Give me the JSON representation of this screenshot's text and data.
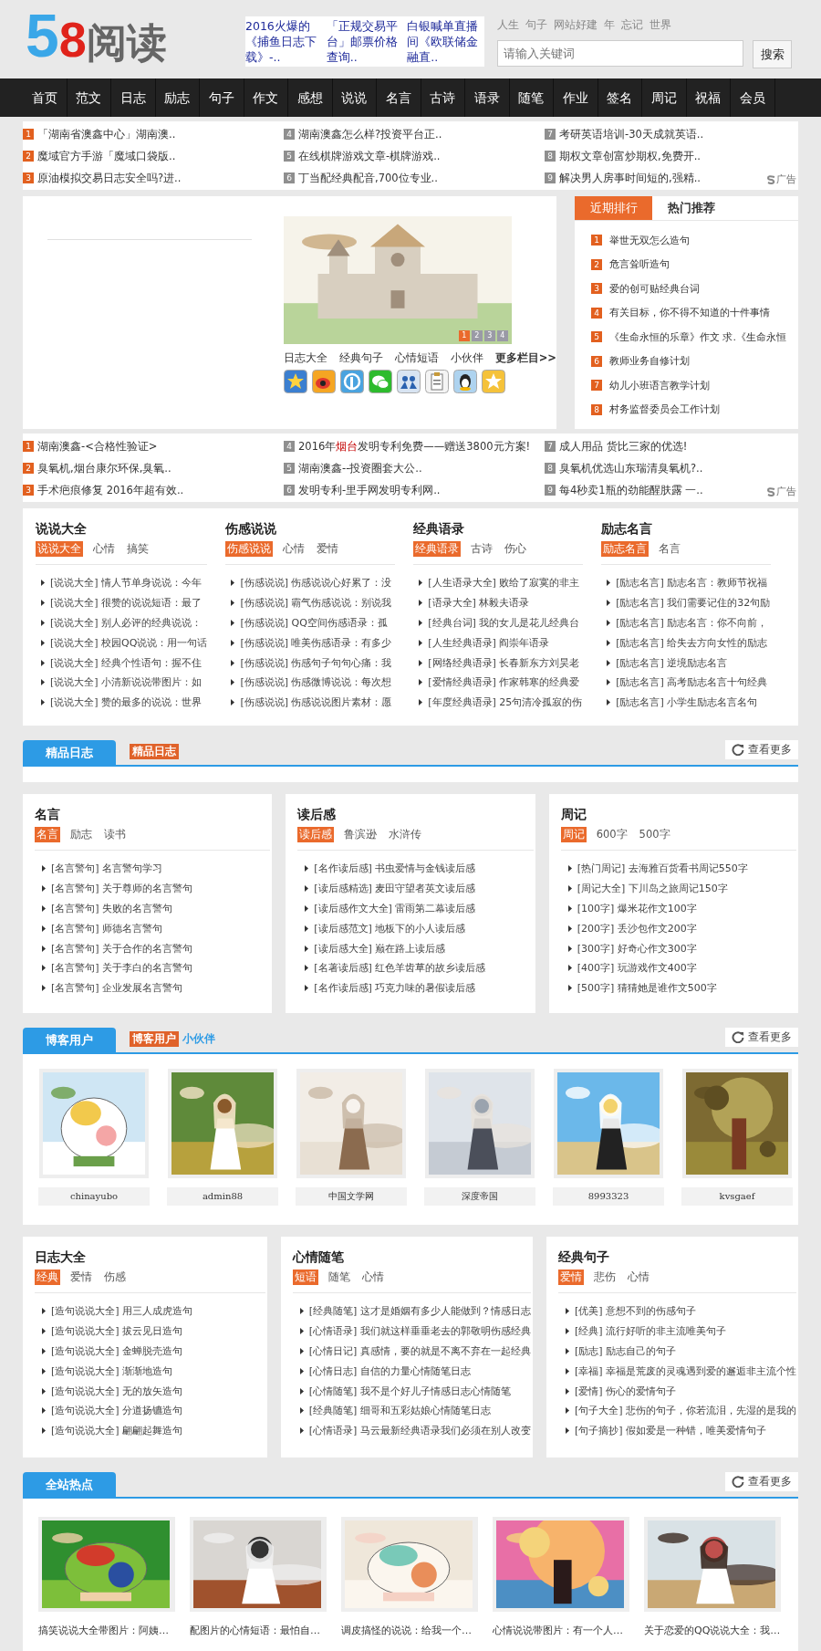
{
  "header": {
    "logo": {
      "digit_1": "5",
      "digit_2": "8",
      "text": "阅读"
    },
    "promo": [
      "2016火爆的《捕鱼日志下载》-..",
      "「正规交易平台」邮票价格查询..",
      "白银喊单直播间《欧联储金融直.."
    ],
    "links": [
      "人生",
      "句子",
      "网站好建",
      "年",
      "忘记",
      "世界"
    ],
    "search": {
      "placeholder": "请输入关键词",
      "button": "搜索"
    }
  },
  "nav": [
    "首页",
    "范文",
    "日志",
    "励志",
    "句子",
    "作文",
    "感想",
    "说说",
    "名言",
    "古诗",
    "语录",
    "随笔",
    "作业",
    "签名",
    "周记",
    "祝福",
    "会员"
  ],
  "ads_top": {
    "ad_label": "广告",
    "items": [
      {
        "num": "1",
        "hot": true,
        "text": "「湖南省澳鑫中心」湖南澳.."
      },
      {
        "num": "2",
        "hot": true,
        "text": "魔域官方手游「魔域口袋版.."
      },
      {
        "num": "3",
        "hot": true,
        "text": "原油模拟交易日志安全吗?进.."
      },
      {
        "num": "4",
        "hot": false,
        "text": "湖南澳鑫怎么样?投资平台正.."
      },
      {
        "num": "5",
        "hot": false,
        "text": "在线棋牌游戏文章-棋牌游戏.."
      },
      {
        "num": "6",
        "hot": false,
        "text": "丁当配经典配音,700位专业.."
      },
      {
        "num": "7",
        "hot": false,
        "text": "考研英语培训-30天成就英语.."
      },
      {
        "num": "8",
        "hot": false,
        "text": "期权文章创富炒期权,免费开.."
      },
      {
        "num": "9",
        "hot": false,
        "text": "解决男人房事时间短的,强精.."
      }
    ]
  },
  "slider": {
    "pages": [
      {
        "label": "1",
        "selected": true
      },
      {
        "label": "2",
        "selected": false
      },
      {
        "label": "3",
        "selected": false
      },
      {
        "label": "4",
        "selected": false
      }
    ],
    "links": [
      "日志大全",
      "经典句子",
      "心情短语",
      "小伙伴"
    ],
    "more": "更多栏目>>"
  },
  "ranking": {
    "tabs": [
      {
        "label": "近期排行",
        "selected": true
      },
      {
        "label": "热门推荐",
        "selected": false
      }
    ],
    "items": [
      {
        "num": "1",
        "text": "举世无双怎么造句"
      },
      {
        "num": "2",
        "text": "危言耸听造句"
      },
      {
        "num": "3",
        "text": "爱的创可贴经典台词"
      },
      {
        "num": "4",
        "text": "有关目标，你不得不知道的十件事情"
      },
      {
        "num": "5",
        "text": "《生命永恒的乐章》作文 求.《生命永恒"
      },
      {
        "num": "6",
        "text": "教师业务自修计划"
      },
      {
        "num": "7",
        "text": "幼儿小班语言教学计划"
      },
      {
        "num": "8",
        "text": "村务监督委员会工作计划"
      }
    ]
  },
  "ads_mid": {
    "ad_label": "广告",
    "items": [
      {
        "num": "1",
        "hot": true,
        "text": "湖南澳鑫-<合格性验证>"
      },
      {
        "num": "2",
        "hot": true,
        "text": "臭氧机,烟台康尔环保,臭氧.."
      },
      {
        "num": "3",
        "hot": true,
        "text": "手术疤痕修复 2016年超有效.."
      },
      {
        "num": "4",
        "hot": false,
        "text": "2016年**烟台**发明专利免费——赠送3800元方案!"
      },
      {
        "num": "5",
        "hot": false,
        "text": "湖南澳鑫--投资圈套大公.."
      },
      {
        "num": "6",
        "hot": false,
        "text": "发明专利-里手网发明专利网.."
      },
      {
        "num": "7",
        "hot": false,
        "text": "成人用品 货比三家的优选!"
      },
      {
        "num": "8",
        "hot": false,
        "text": "臭氧机优选山东瑞清臭氧机?.."
      },
      {
        "num": "9",
        "hot": false,
        "text": "每4秒卖1瓶的劲能醒肤露 一.."
      }
    ]
  },
  "columns_4": [
    {
      "title": "说说大全",
      "tags": [
        {
          "label": "说说大全",
          "selected": true
        },
        {
          "label": "心情",
          "selected": false
        },
        {
          "label": "搞笑",
          "selected": false
        }
      ],
      "items": [
        "[说说大全] 情人节单身说说：今年",
        "[说说大全] 很赞的说说短语：最了",
        "[说说大全] 别人必评的经典说说：",
        "[说说大全] 校园QQ说说：用一句话",
        "[说说大全] 经典个性语句：握不住",
        "[说说大全] 小清新说说带图片：如",
        "[说说大全] 赞的最多的说说：世界"
      ]
    },
    {
      "title": "伤感说说",
      "tags": [
        {
          "label": "伤感说说",
          "selected": true
        },
        {
          "label": "心情",
          "selected": false
        },
        {
          "label": "爱情",
          "selected": false
        }
      ],
      "items": [
        "[伤感说说] 伤感说说心好累了：没",
        "[伤感说说] 霸气伤感说说：别说我",
        "[伤感说说] QQ空间伤感语录：孤",
        "[伤感说说] 唯美伤感语录：有多少",
        "[伤感说说] 伤感句子句句心痛：我",
        "[伤感说说] 伤感微博说说：每次想",
        "[伤感说说] 伤感说说图片素材：愿"
      ]
    },
    {
      "title": "经典语录",
      "tags": [
        {
          "label": "经典语录",
          "selected": true
        },
        {
          "label": "古诗",
          "selected": false
        },
        {
          "label": "伤心",
          "selected": false
        }
      ],
      "items": [
        "[人生语录大全] 败给了寂寞的非主",
        "[语录大全] 林毅夫语录",
        "[经典台词] 我的女儿是花儿经典台",
        "[人生经典语录] 阎崇年语录",
        "[网络经典语录] 长春新东方刘昊老",
        "[爱情经典语录] 作家韩寒的经典爱",
        "[年度经典语录] 25句清冷孤寂的伤"
      ]
    },
    {
      "title": "励志名言",
      "tags": [
        {
          "label": "励志名言",
          "selected": true
        },
        {
          "label": "名言",
          "selected": false
        }
      ],
      "items": [
        "[励志名言] 励志名言：教师节祝福",
        "[励志名言] 我们需要记住的32句励",
        "[励志名言] 励志名言：你不向前，",
        "[励志名言] 给失去方向女性的励志",
        "[励志名言] 逆境励志名言",
        "[励志名言] 高考励志名言十句经典",
        "[励志名言] 小学生励志名言名句"
      ]
    }
  ],
  "section_diary": {
    "tab": "精品日志",
    "tag": "精品日志",
    "more": "查看更多"
  },
  "columns_3a": [
    {
      "title": "名言",
      "tags": [
        {
          "label": "名言",
          "selected": true
        },
        {
          "label": "励志",
          "selected": false
        },
        {
          "label": "读书",
          "selected": false
        }
      ],
      "items": [
        "[名言警句] 名言警句学习",
        "[名言警句] 关于尊师的名言警句",
        "[名言警句] 失败的名言警句",
        "[名言警句] 师德名言警句",
        "[名言警句] 关于合作的名言警句",
        "[名言警句] 关于李白的名言警句",
        "[名言警句] 企业发展名言警句"
      ]
    },
    {
      "title": "读后感",
      "tags": [
        {
          "label": "读后感",
          "selected": true
        },
        {
          "label": "鲁滨逊",
          "selected": false
        },
        {
          "label": "水浒传",
          "selected": false
        }
      ],
      "items": [
        "[名作读后感] 书虫爱情与金钱读后感",
        "[读后感精选] 麦田守望者英文读后感",
        "[读后感作文大全] 雷雨第二幕读后感",
        "[读后感范文] 地板下的小人读后感",
        "[读后感大全] 巅在路上读后感",
        "[名著读后感] 红色羊齿草的故乡读后感",
        "[名作读后感] 巧克力味的暑假读后感"
      ]
    },
    {
      "title": "周记",
      "tags": [
        {
          "label": "周记",
          "selected": true
        },
        {
          "label": "600字",
          "selected": false
        },
        {
          "label": "500字",
          "selected": false
        }
      ],
      "items": [
        "[热门周记] 去海雅百货看书周记550字",
        "[周记大全] 下川岛之旅周记150字",
        "[100字] 爆米花作文100字",
        "[200字] 丢沙包作文200字",
        "[300字] 好奇心作文300字",
        "[400字] 玩游戏作文400字",
        "[500字] 猜猜她是谁作文500字"
      ]
    }
  ],
  "section_blog": {
    "tab": "博客用户",
    "tag": "博客用户",
    "link": "小伙伴",
    "more": "查看更多",
    "users": [
      {
        "name": "chinayubo"
      },
      {
        "name": "admin88"
      },
      {
        "name": "中国文学网"
      },
      {
        "name": "深度帝国"
      },
      {
        "name": "8993323"
      },
      {
        "name": "kvsgaef"
      }
    ]
  },
  "columns_3b": [
    {
      "title": "日志大全",
      "tags": [
        {
          "label": "经典",
          "selected": true
        },
        {
          "label": "爱情",
          "selected": false
        },
        {
          "label": "伤感",
          "selected": false
        }
      ],
      "items": [
        "[造句说说大全] 用三人成虎造句",
        "[造句说说大全] 拔云见日造句",
        "[造句说说大全] 金蝉脱壳造句",
        "[造句说说大全] 渐渐地造句",
        "[造句说说大全] 无的放矢造句",
        "[造句说说大全] 分道扬镳造句",
        "[造句说说大全] 翩翩起舞造句"
      ]
    },
    {
      "title": "心情随笔",
      "tags": [
        {
          "label": "短语",
          "selected": true
        },
        {
          "label": "随笔",
          "selected": false
        },
        {
          "label": "心情",
          "selected": false
        }
      ],
      "items": [
        "[经典随笔] 这才是婚姻有多少人能做到？情感日志",
        "[心情语录] 我们就这样垂垂老去的郭敬明伤感经典",
        "[心情日记] 真感情，要的就是不离不弃在一起经典",
        "[心情日志] 自信的力量心情随笔日志",
        "[心情随笔] 我不是个好儿子情感日志心情随笔",
        "[经典随笔] 细哥和五彩姑娘心情随笔日志",
        "[心情语录] 马云最新经典语录我们必须在别人改变"
      ]
    },
    {
      "title": "经典句子",
      "tags": [
        {
          "label": "爱情",
          "selected": true
        },
        {
          "label": "悲伤",
          "selected": false
        },
        {
          "label": "心情",
          "selected": false
        }
      ],
      "items": [
        "[优美] 意想不到的伤感句子",
        "[经典] 流行好听的非主流唯美句子",
        "[励志] 励志自己的句子",
        "[幸福] 幸福是荒废的灵魂遇到爱的邂逅非主流个性",
        "[爱情] 伤心的爱情句子",
        "[句子大全] 悲伤的句子，你若流泪，先湿的是我的",
        "[句子摘抄] 假如爱是一种错，唯美爱情句子"
      ]
    }
  ],
  "section_hot": {
    "tab": "全站热点",
    "more": "查看更多",
    "posts": [
      {
        "caption": "搞笑说说大全带图片：阿姨…"
      },
      {
        "caption": "配图片的心情短语：最怕自…"
      },
      {
        "caption": "调皮搞怪的说说：给我一个…"
      },
      {
        "caption": "心情说说带图片：有一个人…"
      },
      {
        "caption": "关于恋爱的QQ说说大全：我…"
      }
    ]
  }
}
